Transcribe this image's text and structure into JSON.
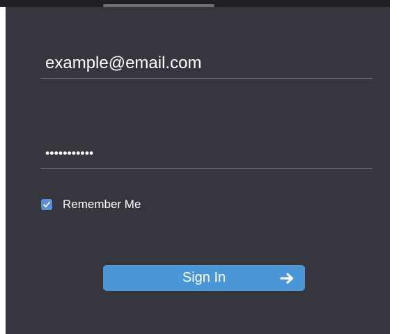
{
  "form": {
    "email": {
      "value": "example@email.com"
    },
    "password": {
      "masked_value": "•••••••••••"
    },
    "remember_me": {
      "label": "Remember Me",
      "checked": true
    },
    "sign_in": {
      "label": "Sign In",
      "icon": "arrow-right-icon"
    }
  },
  "colors": {
    "panel_background": "#36363e",
    "accent": "#4a96d6",
    "checkbox": "#5b8ed6",
    "text": "#ffffff",
    "divider": "#74757c"
  }
}
